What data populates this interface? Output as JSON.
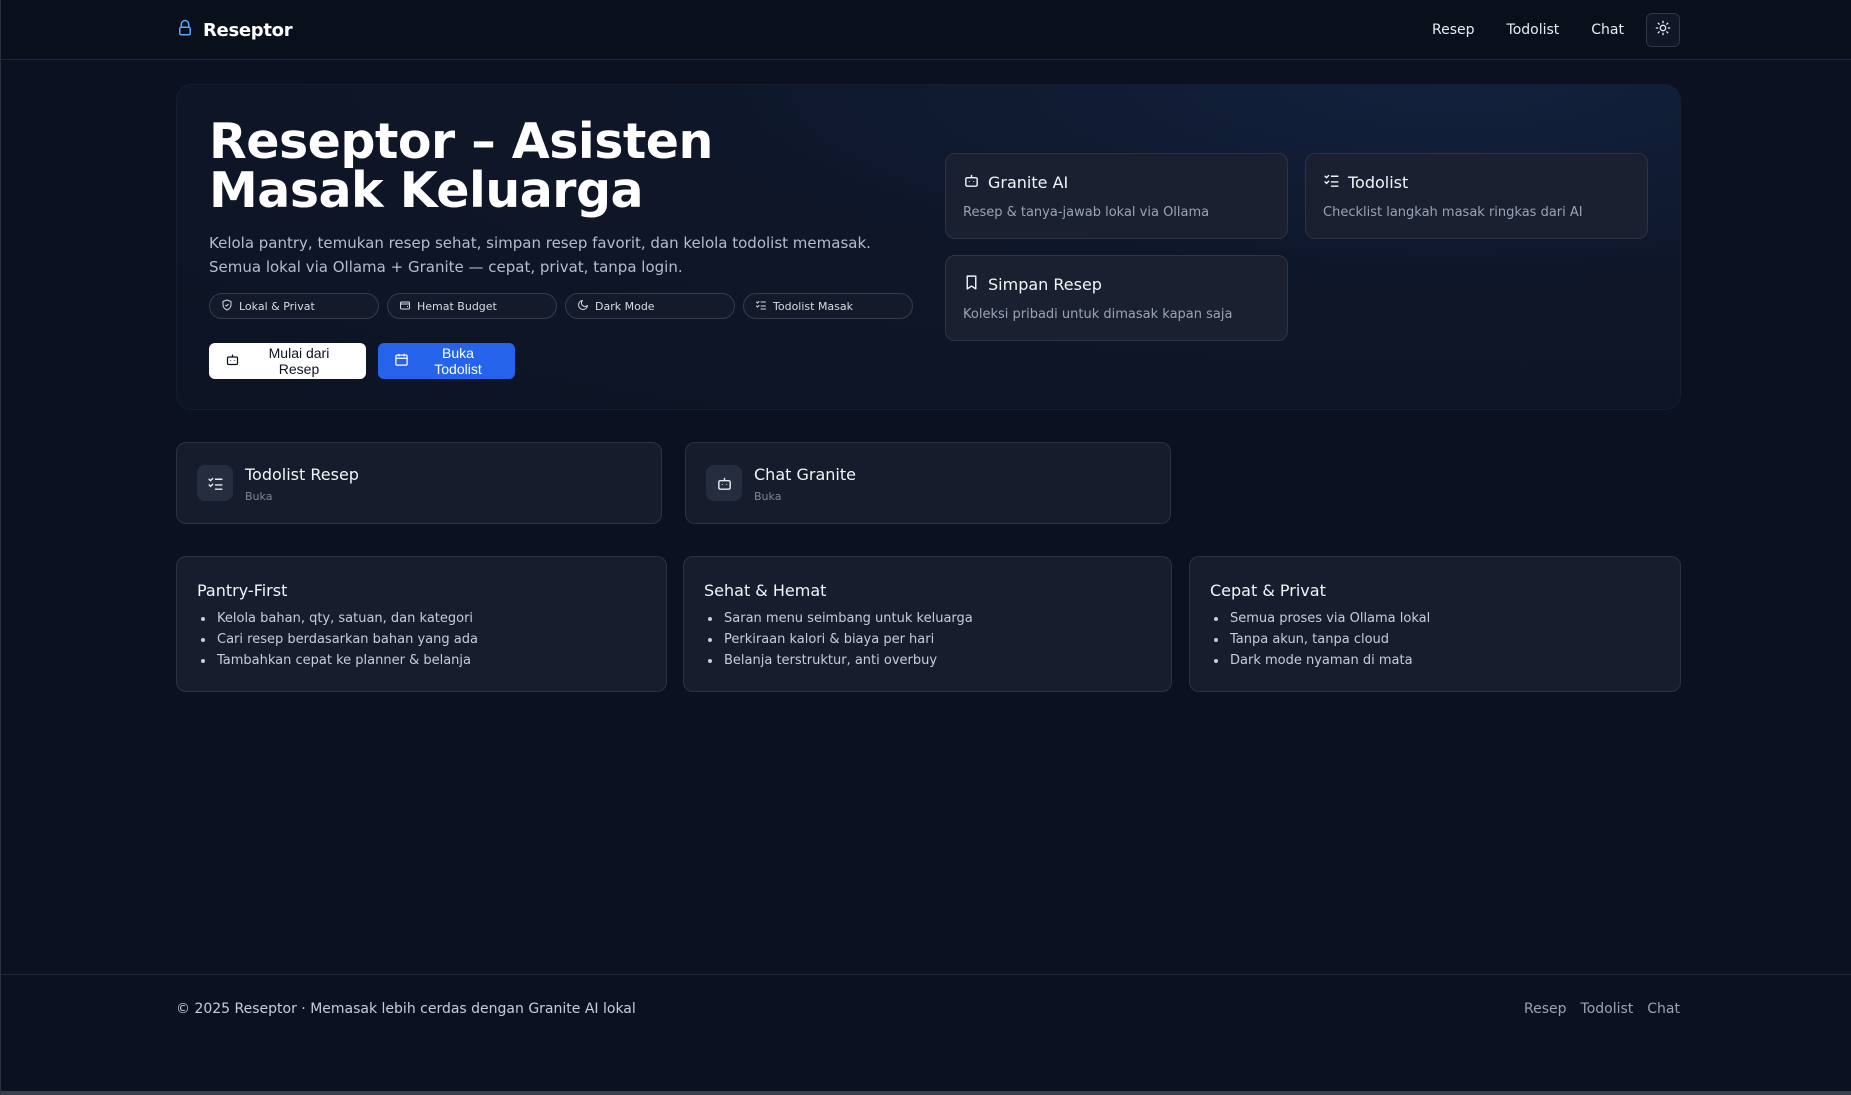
{
  "app": {
    "name": "Reseptor"
  },
  "nav": {
    "items": [
      "Resep",
      "Todolist",
      "Chat"
    ],
    "theme_icon": "sun-icon"
  },
  "hero": {
    "title": "Reseptor – Asisten Masak Keluarga",
    "subtitle": "Kelola pantry, temukan resep sehat, simpan resep favorit, dan kelola todolist memasak. Semua lokal via Ollama + Granite — cepat, privat, tanpa login.",
    "chips": [
      {
        "label": "Lokal & Privat",
        "icon": "shield-icon"
      },
      {
        "label": "Hemat Budget",
        "icon": "wallet-icon"
      },
      {
        "label": "Dark Mode",
        "icon": "moon-icon"
      },
      {
        "label": "Todolist Masak",
        "icon": "list-checks-icon"
      }
    ],
    "primary_button": "Mulai dari Resep",
    "secondary_button": "Buka Todolist",
    "features": [
      {
        "title": "Granite AI",
        "desc": "Resep & tanya-jawab lokal via Ollama",
        "icon": "bot-icon"
      },
      {
        "title": "Todolist",
        "desc": "Checklist langkah masak ringkas dari AI",
        "icon": "list-checks-icon"
      },
      {
        "title": "Simpan Resep",
        "desc": "Koleksi pribadi untuk dimasak kapan saja",
        "icon": "bookmark-icon"
      }
    ]
  },
  "quick_links": [
    {
      "title": "Todolist Resep",
      "sub": "Buka",
      "icon": "list-checks-icon"
    },
    {
      "title": "Chat Granite",
      "sub": "Buka",
      "icon": "bot-icon"
    }
  ],
  "info_cards": [
    {
      "title": "Pantry-First",
      "items": [
        "Kelola bahan, qty, satuan, dan kategori",
        "Cari resep berdasarkan bahan yang ada",
        "Tambahkan cepat ke planner & belanja"
      ]
    },
    {
      "title": "Sehat & Hemat",
      "items": [
        "Saran menu seimbang untuk keluarga",
        "Perkiraan kalori & biaya per hari",
        "Belanja terstruktur, anti overbuy"
      ]
    },
    {
      "title": "Cepat & Privat",
      "items": [
        "Semua proses via Ollama lokal",
        "Tanpa akun, tanpa cloud",
        "Dark mode nyaman di mata"
      ]
    }
  ],
  "footer": {
    "text": "© 2025 Reseptor · Memasak lebih cerdas dengan Granite AI lokal",
    "links": [
      "Resep",
      "Todolist",
      "Chat"
    ]
  },
  "colors": {
    "accent": "#2563eb",
    "background": "#0c1121",
    "brand_icon": "#60a5fa"
  }
}
